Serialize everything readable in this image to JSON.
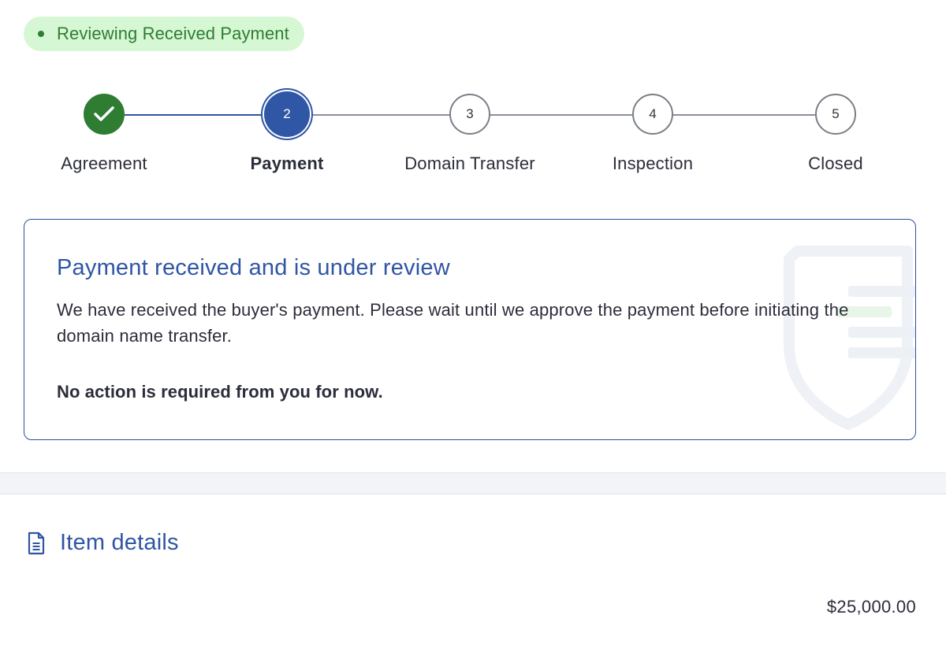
{
  "status": {
    "label": "Reviewing Received Payment",
    "color": "#2e7d32",
    "background": "#d6f7d4"
  },
  "stepper": {
    "steps": [
      {
        "number": "",
        "label": "Agreement",
        "state": "complete",
        "icon": "checkmark-icon"
      },
      {
        "number": "2",
        "label": "Payment",
        "state": "current"
      },
      {
        "number": "3",
        "label": "Domain Transfer",
        "state": "upcoming"
      },
      {
        "number": "4",
        "label": "Inspection",
        "state": "upcoming"
      },
      {
        "number": "5",
        "label": "Closed",
        "state": "upcoming"
      }
    ]
  },
  "notice": {
    "title": "Payment received and is under review",
    "body": "We have received the buyer's payment. Please wait until we approve the payment before initiating the domain name transfer.",
    "note": "No action is required from you for now.",
    "watermark_icon": "shield-icon"
  },
  "item_details": {
    "title": "Item details",
    "icon": "document-icon",
    "price": "$25,000.00"
  },
  "colors": {
    "accent": "#2f55a4",
    "success": "#2e7d32",
    "text": "#2b2d3a"
  }
}
